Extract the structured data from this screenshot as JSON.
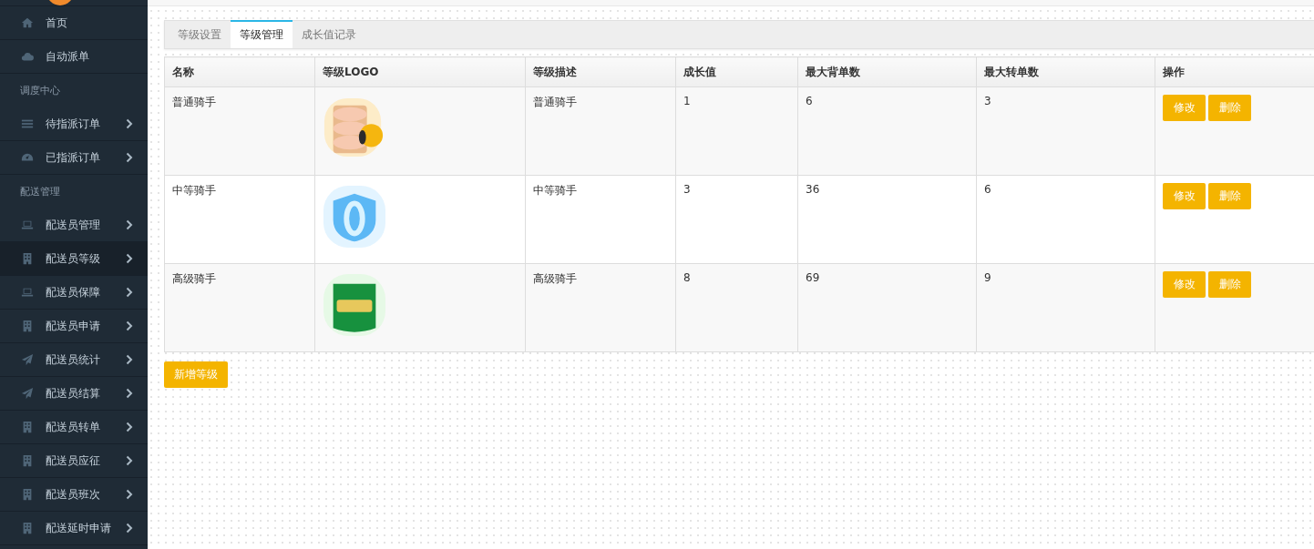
{
  "sidebar": {
    "items": [
      {
        "kind": "link",
        "label": "首页",
        "selected": false
      },
      {
        "kind": "link",
        "label": "自动派单",
        "selected": false
      },
      {
        "kind": "section",
        "label": "调度中心"
      },
      {
        "kind": "menu",
        "label": "待指派订单",
        "selected": false
      },
      {
        "kind": "menu",
        "label": "已指派订单",
        "selected": false
      },
      {
        "kind": "section",
        "label": "配送管理"
      },
      {
        "kind": "menu",
        "label": "配送员管理",
        "selected": false
      },
      {
        "kind": "menu",
        "label": "配送员等级",
        "selected": true
      },
      {
        "kind": "menu",
        "label": "配送员保障",
        "selected": false
      },
      {
        "kind": "menu",
        "label": "配送员申请",
        "selected": false
      },
      {
        "kind": "menu",
        "label": "配送员统计",
        "selected": false
      },
      {
        "kind": "menu",
        "label": "配送员结算",
        "selected": false
      },
      {
        "kind": "menu",
        "label": "配送员转单",
        "selected": false
      },
      {
        "kind": "menu",
        "label": "配送员应征",
        "selected": false
      },
      {
        "kind": "menu",
        "label": "配送员班次",
        "selected": false
      },
      {
        "kind": "menu",
        "label": "配送延时申请",
        "selected": false
      }
    ]
  },
  "tabs": [
    {
      "label": "等级设置",
      "selected": false
    },
    {
      "label": "等级管理",
      "selected": true
    },
    {
      "label": "成长值记录",
      "selected": false
    }
  ],
  "table": {
    "columns": [
      "名称",
      "等级LOGO",
      "等级描述",
      "成长值",
      "最大背单数",
      "最大转单数",
      "操作"
    ],
    "rows": [
      {
        "name": "普通骑手",
        "description": "普通骑手",
        "growth": "1",
        "max_carry": "6",
        "max_transfer": "3",
        "actions": [
          "修改",
          "删除"
        ]
      },
      {
        "name": "中等骑手",
        "description": "中等骑手",
        "growth": "3",
        "max_carry": "36",
        "max_transfer": "6",
        "actions": [
          "修改",
          "删除"
        ]
      },
      {
        "name": "高级骑手",
        "description": "高级骑手",
        "growth": "8",
        "max_carry": "69",
        "max_transfer": "9",
        "actions": [
          "修改",
          "删除"
        ]
      }
    ]
  },
  "add_button": "新增等级"
}
